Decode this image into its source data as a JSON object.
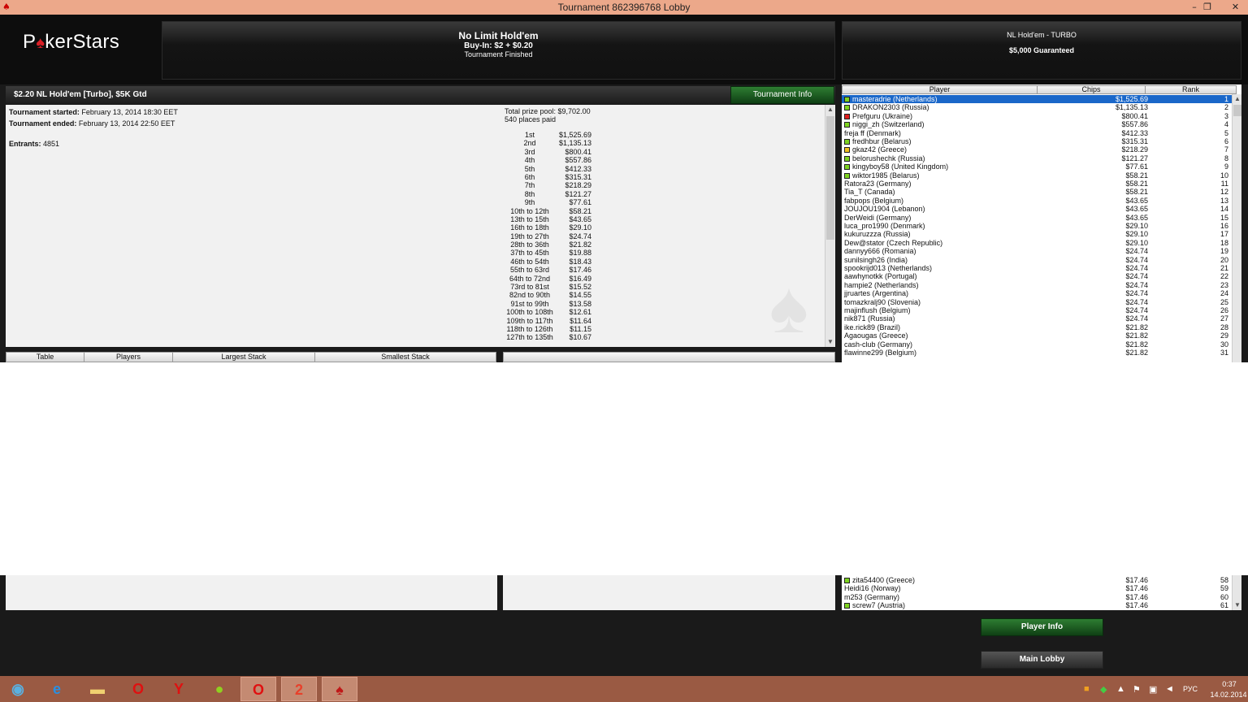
{
  "window": {
    "title": "Tournament 862396768 Lobby",
    "minimize": "–",
    "restore": "❐",
    "close": "✕"
  },
  "logo": {
    "left": "P",
    "spade": "♠",
    "right": "kerStars"
  },
  "header_center": {
    "game": "No Limit Hold'em",
    "buyin": "Buy-In: $2 + $0.20",
    "status": "Tournament Finished"
  },
  "header_right": {
    "game": "NL Hold'em - TURBO",
    "guarantee": "$5,000 Guaranteed"
  },
  "tournament_bar": {
    "name": "$2.20 NL Hold'em [Turbo], $5K Gtd",
    "info_button": "Tournament Info"
  },
  "info": {
    "started_label": "Tournament started:",
    "started_value": "February 13, 2014 18:30 EET",
    "ended_label": "Tournament ended:",
    "ended_value": "February 13, 2014 22:50 EET",
    "entrants_label": "Entrants:",
    "entrants_value": "4851",
    "prize_pool": "Total prize pool: $9,702.00",
    "places_paid": "540 places paid"
  },
  "prizes": [
    {
      "place": "1st",
      "amount": "$1,525.69"
    },
    {
      "place": "2nd",
      "amount": "$1,135.13"
    },
    {
      "place": "3rd",
      "amount": "$800.41"
    },
    {
      "place": "4th",
      "amount": "$557.86"
    },
    {
      "place": "5th",
      "amount": "$412.33"
    },
    {
      "place": "6th",
      "amount": "$315.31"
    },
    {
      "place": "7th",
      "amount": "$218.29"
    },
    {
      "place": "8th",
      "amount": "$121.27"
    },
    {
      "place": "9th",
      "amount": "$77.61"
    },
    {
      "place": "10th to 12th",
      "amount": "$58.21"
    },
    {
      "place": "13th to 15th",
      "amount": "$43.65"
    },
    {
      "place": "16th to 18th",
      "amount": "$29.10"
    },
    {
      "place": "19th to 27th",
      "amount": "$24.74"
    },
    {
      "place": "28th to 36th",
      "amount": "$21.82"
    },
    {
      "place": "37th to 45th",
      "amount": "$19.88"
    },
    {
      "place": "46th to 54th",
      "amount": "$18.43"
    },
    {
      "place": "55th to 63rd",
      "amount": "$17.46"
    },
    {
      "place": "64th to 72nd",
      "amount": "$16.49"
    },
    {
      "place": "73rd to 81st",
      "amount": "$15.52"
    },
    {
      "place": "82nd to 90th",
      "amount": "$14.55"
    },
    {
      "place": "91st to 99th",
      "amount": "$13.58"
    },
    {
      "place": "100th to 108th",
      "amount": "$12.61"
    },
    {
      "place": "109th to 117th",
      "amount": "$11.64"
    },
    {
      "place": "118th to 126th",
      "amount": "$11.15"
    },
    {
      "place": "127th to 135th",
      "amount": "$10.67"
    }
  ],
  "tables_columns": [
    "Table",
    "Players",
    "Largest Stack",
    "Smallest Stack"
  ],
  "player_columns": [
    "Player",
    "Chips",
    "Rank"
  ],
  "colors": {
    "flag_green": "#7ed321",
    "flag_red": "#e02020",
    "flag_yellow": "#f0c020",
    "selected": "#1a67c9"
  },
  "players": [
    {
      "name": "masteradrie (Netherlands)",
      "chips": "$1,525.69",
      "rank": "1",
      "flag": "green"
    },
    {
      "name": "DRAKON2303 (Russia)",
      "chips": "$1,135.13",
      "rank": "2",
      "flag": "green"
    },
    {
      "name": "Prefguru (Ukraine)",
      "chips": "$800.41",
      "rank": "3",
      "flag": "red"
    },
    {
      "name": "niggi_zh (Switzerland)",
      "chips": "$557.86",
      "rank": "4",
      "flag": "green"
    },
    {
      "name": "freja ff (Denmark)",
      "chips": "$412.33",
      "rank": "5",
      "flag": ""
    },
    {
      "name": "fredhbur (Belarus)",
      "chips": "$315.31",
      "rank": "6",
      "flag": "green"
    },
    {
      "name": "gkaz42 (Greece)",
      "chips": "$218.29",
      "rank": "7",
      "flag": "yellow"
    },
    {
      "name": "belorushechk (Russia)",
      "chips": "$121.27",
      "rank": "8",
      "flag": "green"
    },
    {
      "name": "kingyboy58 (United Kingdom)",
      "chips": "$77.61",
      "rank": "9",
      "flag": "green"
    },
    {
      "name": "wiktor1985 (Belarus)",
      "chips": "$58.21",
      "rank": "10",
      "flag": "green"
    },
    {
      "name": "Ratora23 (Germany)",
      "chips": "$58.21",
      "rank": "11",
      "flag": ""
    },
    {
      "name": "Tia_T (Canada)",
      "chips": "$58.21",
      "rank": "12",
      "flag": ""
    },
    {
      "name": "fabpops (Belgium)",
      "chips": "$43.65",
      "rank": "13",
      "flag": ""
    },
    {
      "name": "JOUJOU1904 (Lebanon)",
      "chips": "$43.65",
      "rank": "14",
      "flag": ""
    },
    {
      "name": "DerWeidi (Germany)",
      "chips": "$43.65",
      "rank": "15",
      "flag": ""
    },
    {
      "name": "luca_pro1990 (Denmark)",
      "chips": "$29.10",
      "rank": "16",
      "flag": ""
    },
    {
      "name": "kukuruzzza (Russia)",
      "chips": "$29.10",
      "rank": "17",
      "flag": ""
    },
    {
      "name": "Dew@stator (Czech Republic)",
      "chips": "$29.10",
      "rank": "18",
      "flag": ""
    },
    {
      "name": "dannyy666 (Romania)",
      "chips": "$24.74",
      "rank": "19",
      "flag": ""
    },
    {
      "name": "sunilsingh26 (India)",
      "chips": "$24.74",
      "rank": "20",
      "flag": ""
    },
    {
      "name": "spookrijd013 (Netherlands)",
      "chips": "$24.74",
      "rank": "21",
      "flag": ""
    },
    {
      "name": "aawhynotkk (Portugal)",
      "chips": "$24.74",
      "rank": "22",
      "flag": ""
    },
    {
      "name": "hampie2 (Netherlands)",
      "chips": "$24.74",
      "rank": "23",
      "flag": ""
    },
    {
      "name": "jjruartes (Argentina)",
      "chips": "$24.74",
      "rank": "24",
      "flag": ""
    },
    {
      "name": "tomazkralj90 (Slovenia)",
      "chips": "$24.74",
      "rank": "25",
      "flag": ""
    },
    {
      "name": "majinflush (Belgium)",
      "chips": "$24.74",
      "rank": "26",
      "flag": ""
    },
    {
      "name": "nik871 (Russia)",
      "chips": "$24.74",
      "rank": "27",
      "flag": ""
    },
    {
      "name": "ike.rick89 (Brazil)",
      "chips": "$21.82",
      "rank": "28",
      "flag": ""
    },
    {
      "name": "Agaougas (Greece)",
      "chips": "$21.82",
      "rank": "29",
      "flag": ""
    },
    {
      "name": "cash-club (Germany)",
      "chips": "$21.82",
      "rank": "30",
      "flag": ""
    },
    {
      "name": "flawinne299 (Belgium)",
      "chips": "$21.82",
      "rank": "31",
      "flag": ""
    }
  ],
  "players_bottom": [
    {
      "name": "zita54400 (Greece)",
      "chips": "$17.46",
      "rank": "58",
      "flag": "green"
    },
    {
      "name": "Heidi16 (Norway)",
      "chips": "$17.46",
      "rank": "59",
      "flag": ""
    },
    {
      "name": "m253 (Germany)",
      "chips": "$17.46",
      "rank": "60",
      "flag": ""
    },
    {
      "name": "screw7 (Austria)",
      "chips": "$17.46",
      "rank": "61",
      "flag": "green"
    }
  ],
  "buttons": {
    "player_info": "Player Info",
    "main_lobby": "Main Lobby"
  },
  "taskbar": {
    "lang": "РУС",
    "time": "0:37",
    "date": "14.02.2014"
  }
}
